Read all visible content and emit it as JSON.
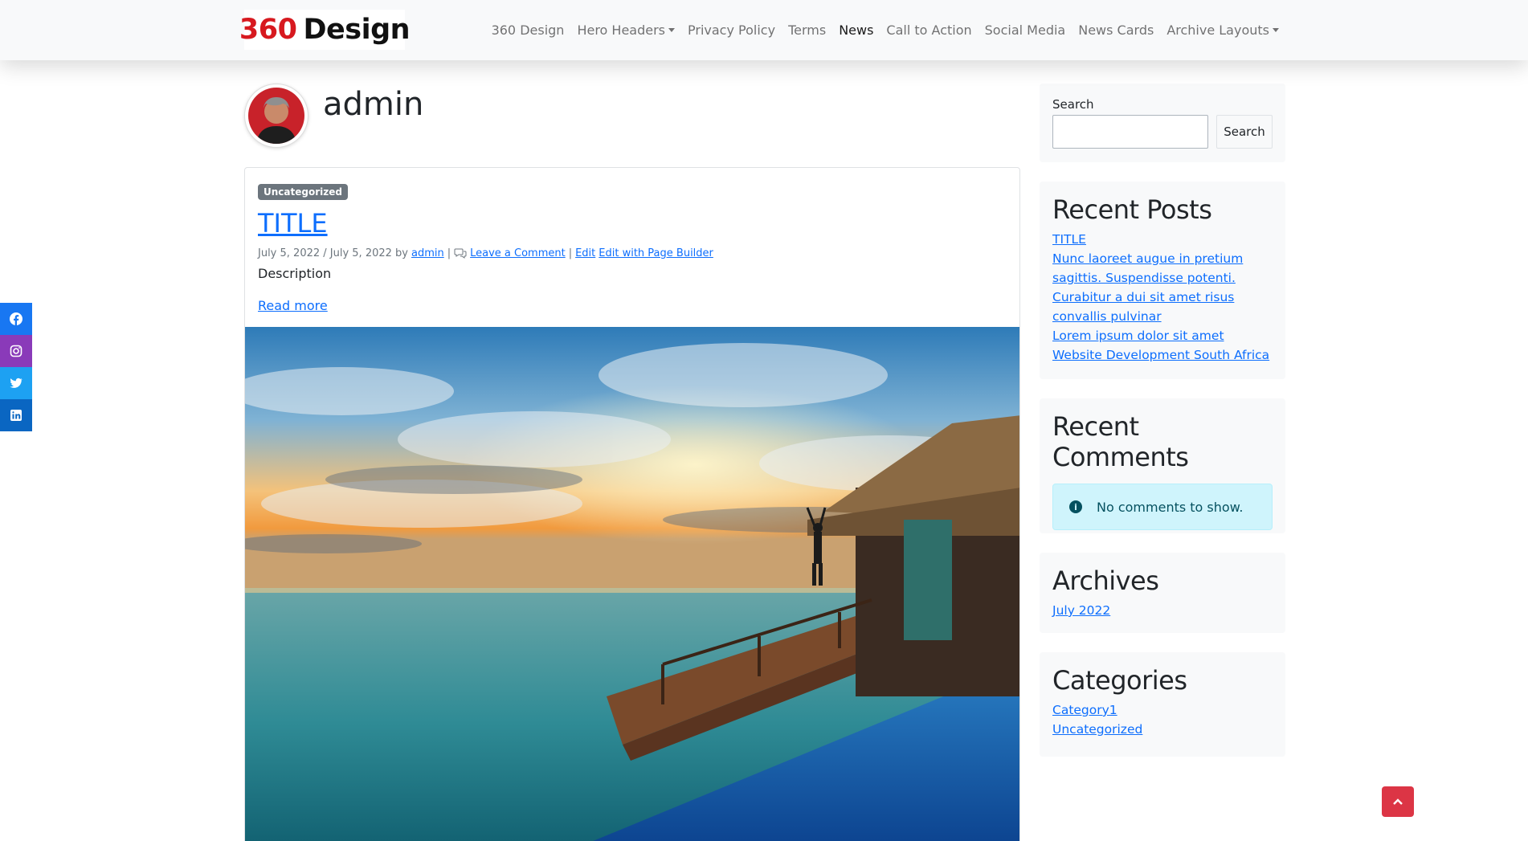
{
  "brand": {
    "part1": "360",
    "part2": "Design"
  },
  "nav": [
    {
      "label": "360 Design"
    },
    {
      "label": "Hero Headers",
      "dropdown": true
    },
    {
      "label": "Privacy Policy"
    },
    {
      "label": "Terms"
    },
    {
      "label": "News",
      "active": true
    },
    {
      "label": "Call to Action"
    },
    {
      "label": "Social Media"
    },
    {
      "label": "News Cards"
    },
    {
      "label": "Archive Layouts",
      "dropdown": true
    }
  ],
  "social": [
    {
      "icon": "facebook-icon",
      "color": "#1877f2"
    },
    {
      "icon": "instagram-icon",
      "color": "#8a3ab9"
    },
    {
      "icon": "twitter-icon",
      "color": "#1da1f2"
    },
    {
      "icon": "linkedin-icon",
      "color": "#0a66c2"
    }
  ],
  "author": {
    "name": "admin"
  },
  "post": {
    "category": "Uncategorized",
    "title": "TITLE",
    "date": "July 5, 2022 / July 5, 2022 by",
    "author_link": "admin",
    "separator1": "|",
    "comment_link": "Leave a Comment",
    "separator2": "|",
    "edit_link": "Edit",
    "edit_builder_link": "Edit with Page Builder",
    "description": "Description",
    "read_more": "Read more"
  },
  "sidebar": {
    "search": {
      "label": "Search",
      "button": "Search",
      "value": ""
    },
    "recent_posts": {
      "title": "Recent Posts",
      "items": [
        "TITLE",
        "Nunc laoreet augue in pretium sagittis. Suspendisse potenti.",
        "Curabitur a dui sit amet risus convallis pulvinar",
        "Lorem ipsum dolor sit amet",
        "Website Development South Africa"
      ]
    },
    "recent_comments": {
      "title": "Recent Comments",
      "empty": "No comments to show."
    },
    "archives": {
      "title": "Archives",
      "items": [
        "July 2022"
      ]
    },
    "categories": {
      "title": "Categories",
      "items": [
        "Category1",
        "Uncategorized"
      ]
    }
  },
  "colors": {
    "brand_red": "#d7191f",
    "link": "#0d6efd",
    "back_to_top": "#dc3545"
  }
}
